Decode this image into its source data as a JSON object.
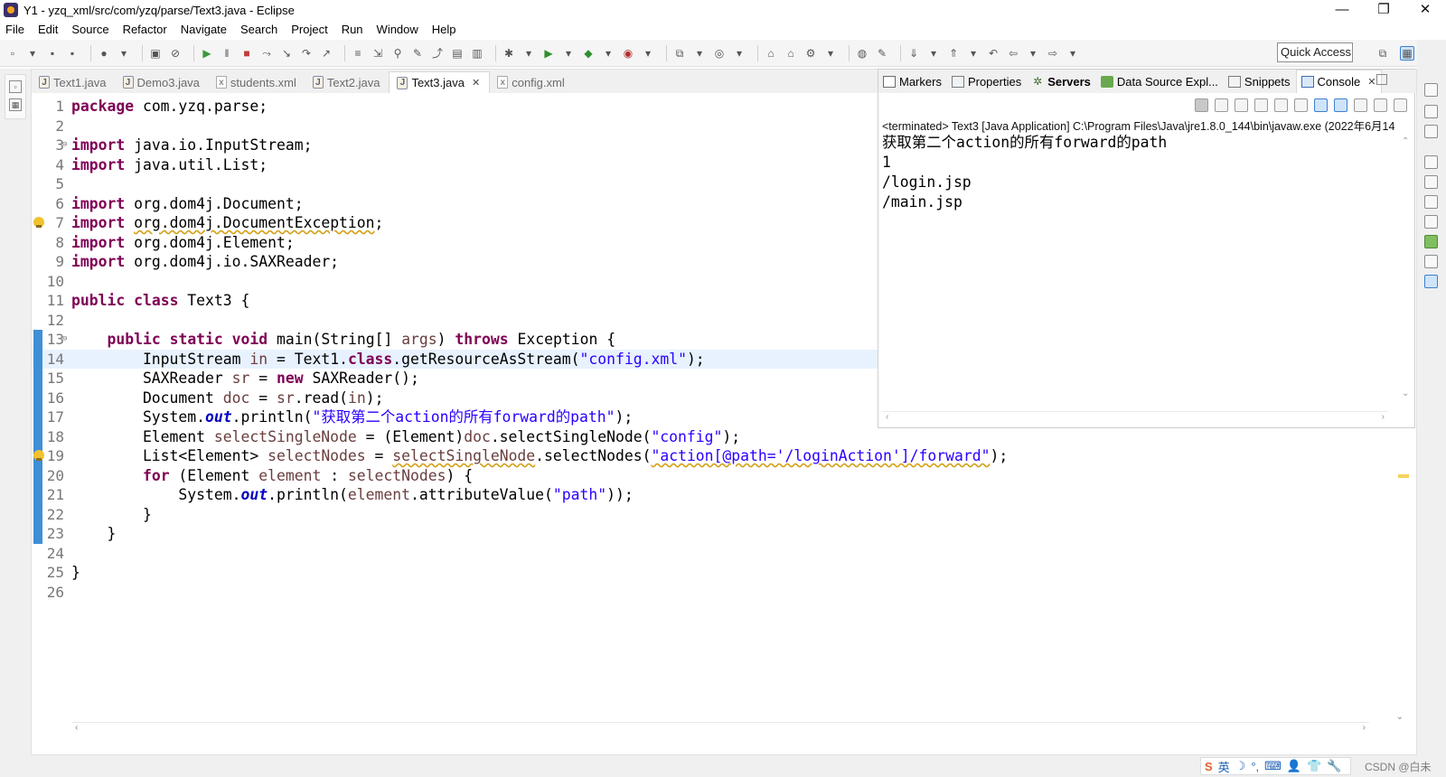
{
  "window": {
    "title": "Y1 - yzq_xml/src/com/yzq/parse/Text3.java - Eclipse",
    "controls": {
      "minimize": "—",
      "maximize": "❐",
      "close": "✕"
    }
  },
  "menu": [
    "File",
    "Edit",
    "Source",
    "Refactor",
    "Navigate",
    "Search",
    "Project",
    "Run",
    "Window",
    "Help"
  ],
  "toolbar": {
    "quick_access": "Quick Access"
  },
  "editor": {
    "tabs": [
      {
        "label": "Text1.java",
        "type": "java"
      },
      {
        "label": "Demo3.java",
        "type": "java"
      },
      {
        "label": "students.xml",
        "type": "xml"
      },
      {
        "label": "Text2.java",
        "type": "java"
      },
      {
        "label": "Text3.java",
        "type": "java",
        "active": true
      },
      {
        "label": "config.xml",
        "type": "xml"
      }
    ],
    "tab_close": "✕",
    "code": [
      "package com.yzq.parse;",
      "",
      "import java.io.InputStream;",
      "import java.util.List;",
      "",
      "import org.dom4j.Document;",
      "import org.dom4j.DocumentException;",
      "import org.dom4j.Element;",
      "import org.dom4j.io.SAXReader;",
      "",
      "public class Text3 {",
      "",
      "    public static void main(String[] args) throws Exception {",
      "        InputStream in = Text1.class.getResourceAsStream(\"config.xml\");",
      "        SAXReader sr = new SAXReader();",
      "        Document doc = sr.read(in);",
      "        System.out.println(\"获取第二个action的所有forward的path\");",
      "        Element selectSingleNode = (Element)doc.selectSingleNode(\"config\");",
      "        List<Element> selectNodes = selectSingleNode.selectNodes(\"action[@path='/loginAction']/forward\");",
      "        for (Element element : selectNodes) {",
      "            System.out.println(element.attributeValue(\"path\"));",
      "        }",
      "    }",
      "",
      "}",
      ""
    ],
    "current_line": 14
  },
  "views": {
    "tabs": [
      {
        "label": "Markers",
        "icon": "markers-icon"
      },
      {
        "label": "Properties",
        "icon": "properties-icon"
      },
      {
        "label": "Servers",
        "icon": "servers-icon",
        "bold": true
      },
      {
        "label": "Data Source Expl...",
        "icon": "data-source-icon"
      },
      {
        "label": "Snippets",
        "icon": "snippets-icon"
      },
      {
        "label": "Console",
        "icon": "console-icon",
        "active": true
      }
    ],
    "console_status": "<terminated> Text3 [Java Application] C:\\Program Files\\Java\\jre1.8.0_144\\bin\\javaw.exe (2022年6月14",
    "console_output": [
      "获取第二个action的所有forward的path",
      "1",
      "/login.jsp",
      "/main.jsp"
    ]
  },
  "statusbar": {
    "ime": [
      "S",
      "英",
      "☽",
      "°,",
      "⌨",
      "👤",
      "👕",
      "🔧"
    ],
    "watermark": "CSDN @白未"
  },
  "colors": {
    "keyword": "#7f0055",
    "string": "#2a00ff",
    "static_field": "#0000c0",
    "local_variable": "#6a3e3e",
    "current_line_bg": "#e8f2fe",
    "change_bar": "#3f8fd6"
  }
}
